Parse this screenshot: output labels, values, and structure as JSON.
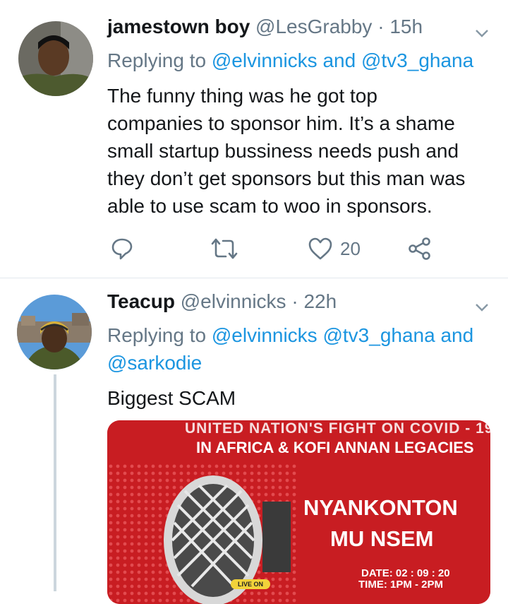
{
  "tweets": [
    {
      "name": "jamestown boy",
      "handle": "@LesGrabby",
      "sep": "·",
      "time": "15h",
      "replying_prefix": "Replying to",
      "mentions": [
        "@elvinnicks",
        "and",
        "@tv3_ghana"
      ],
      "body_lines": [
        "The funny thing was he got top",
        "companies to sponsor him. It’s a shame",
        "small startup bussiness needs push and",
        "they don’t get sponsors but this man was",
        "able to use scam to woo in sponsors."
      ],
      "like_count": "20"
    },
    {
      "name": "Teacup",
      "handle": "@elvinnicks",
      "sep": "·",
      "time": "22h",
      "replying_prefix": "Replying to",
      "mentions": [
        "@elvinnicks",
        "@tv3_ghana",
        "and",
        "@sarkodie"
      ],
      "body": "Biggest SCAM",
      "poster": {
        "line1": "UNITED NATION'S FIGHT ON COVID - 19",
        "line2": "IN AFRICA  & KOFI ANNAN LEGACIES",
        "title1": "NYANKONTON",
        "title2": "MU NSEM",
        "date": "DATE: 02 : 09 : 20",
        "time": "TIME: 1PM - 2PM",
        "badge": "LIVE ON"
      }
    }
  ],
  "colors": {
    "link": "#1b95e0",
    "muted": "#657786",
    "poster_red": "#c81d22"
  }
}
